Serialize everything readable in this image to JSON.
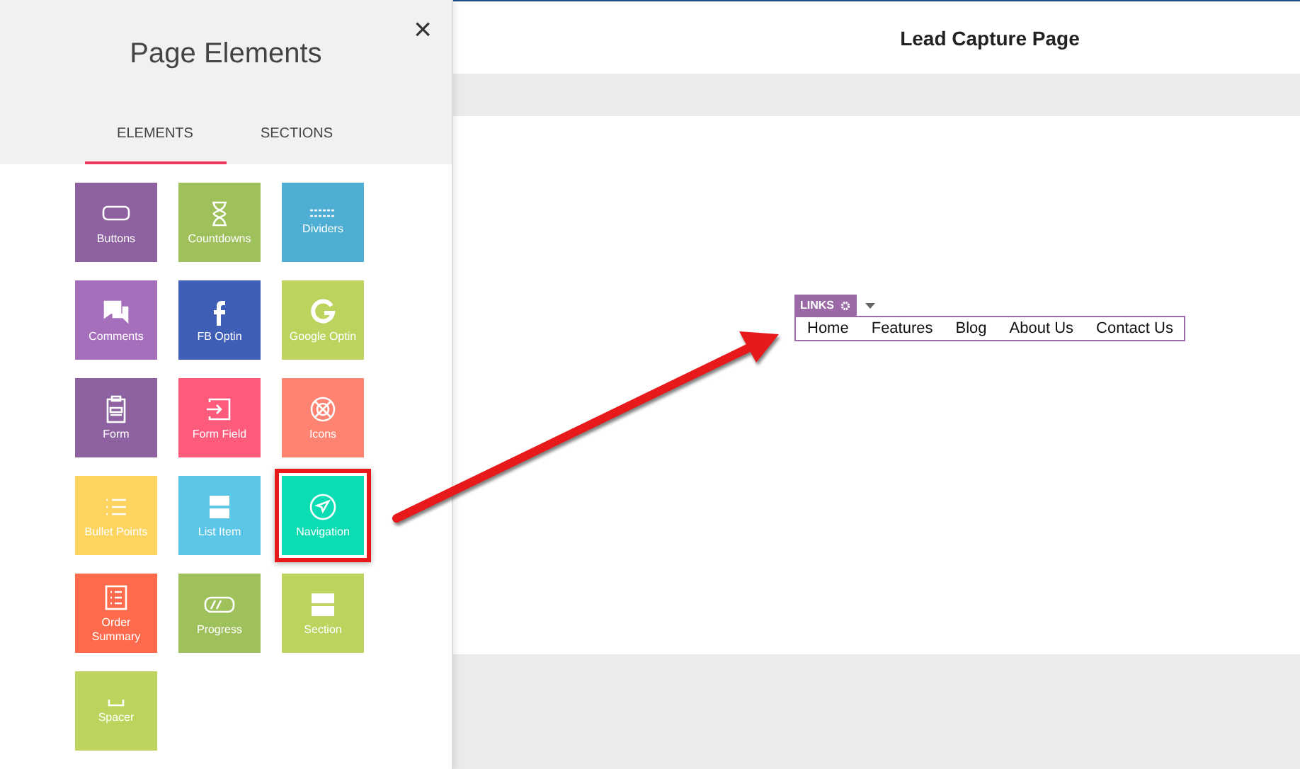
{
  "sidebar": {
    "title": "Page Elements",
    "close": "×",
    "tabs": [
      {
        "label": "ELEMENTS",
        "selected": true
      },
      {
        "label": "SECTIONS",
        "selected": false
      }
    ],
    "elements": [
      {
        "kind": "buttons",
        "label": "Buttons",
        "color": "#8e62a0",
        "selected": false
      },
      {
        "kind": "countdowns",
        "label": "Countdowns",
        "color": "#9fc15b",
        "selected": false
      },
      {
        "kind": "dividers",
        "label": "Dividers",
        "color": "#4faed3",
        "selected": false
      },
      {
        "kind": "comments",
        "label": "Comments",
        "color": "#a66fbc",
        "selected": false
      },
      {
        "kind": "fb",
        "label": "FB Optin",
        "color": "#3f5fb7",
        "selected": false
      },
      {
        "kind": "google",
        "label": "Google Optin",
        "color": "#bcd35e",
        "selected": false
      },
      {
        "kind": "form",
        "label": "Form",
        "color": "#8e62a0",
        "selected": false
      },
      {
        "kind": "formfield",
        "label": "Form Field",
        "color": "#fe5a7c",
        "selected": false
      },
      {
        "kind": "icons",
        "label": "Icons",
        "color": "#fe8370",
        "selected": false
      },
      {
        "kind": "bullets",
        "label": "Bullet Points",
        "color": "#fed460",
        "selected": false
      },
      {
        "kind": "listitem",
        "label": "List Item",
        "color": "#5bc6e8",
        "selected": false
      },
      {
        "kind": "navigation",
        "label": "Navigation",
        "color": "#0cdcb4",
        "selected": true
      },
      {
        "kind": "order",
        "label": "Order Summary",
        "color": "#fe6a4c",
        "selected": false
      },
      {
        "kind": "progress",
        "label": "Progress",
        "color": "#9fc15b",
        "selected": false
      },
      {
        "kind": "section",
        "label": "Section",
        "color": "#bcd35e",
        "selected": false
      },
      {
        "kind": "spacer",
        "label": "Spacer",
        "color": "#bcd35e",
        "selected": false
      }
    ]
  },
  "header": {
    "title": "Lead Capture Page"
  },
  "canvas": {
    "widget": {
      "tag": "LINKS",
      "links": [
        "Home",
        "Features",
        "Blog",
        "About Us",
        "Contact Us"
      ]
    }
  }
}
